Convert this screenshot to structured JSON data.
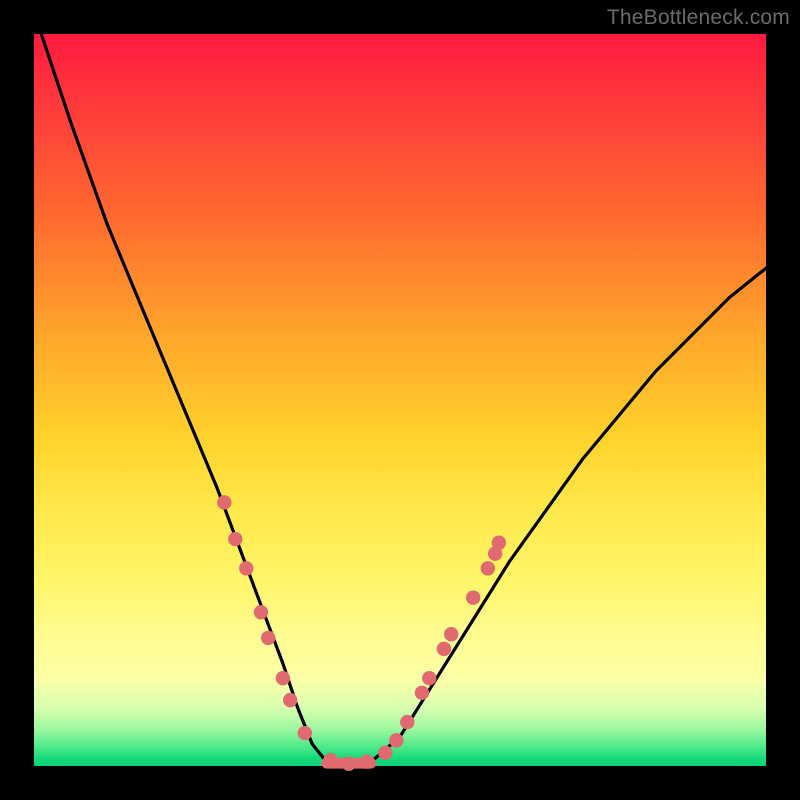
{
  "watermark": "TheBottleneck.com",
  "colors": {
    "frame": "#000000",
    "curve": "#000000",
    "dot": "#e06a6f",
    "gradient_top": "#ff1a3f",
    "gradient_bottom": "#0fd176"
  },
  "chart_data": {
    "type": "line",
    "title": "",
    "xlabel": "",
    "ylabel": "",
    "xlim": [
      0,
      100
    ],
    "ylim": [
      0,
      100
    ],
    "series": [
      {
        "name": "bottleneck-curve",
        "x": [
          1,
          5,
          10,
          15,
          20,
          25,
          28,
          31,
          34,
          36,
          38,
          40,
          43,
          46,
          50,
          55,
          60,
          65,
          70,
          75,
          80,
          85,
          90,
          95,
          100
        ],
        "values": [
          100,
          88,
          74,
          62,
          50,
          38,
          30,
          22,
          14,
          8,
          3,
          0.5,
          0,
          0.5,
          4,
          12,
          20,
          28,
          35,
          42,
          48,
          54,
          59,
          64,
          68
        ]
      }
    ],
    "markers": [
      {
        "x": 26,
        "y": 36
      },
      {
        "x": 27.5,
        "y": 31
      },
      {
        "x": 29,
        "y": 27
      },
      {
        "x": 31,
        "y": 21
      },
      {
        "x": 32,
        "y": 17.5
      },
      {
        "x": 34,
        "y": 12
      },
      {
        "x": 35,
        "y": 9
      },
      {
        "x": 37,
        "y": 4.5
      },
      {
        "x": 40.5,
        "y": 0.8
      },
      {
        "x": 43,
        "y": 0.3
      },
      {
        "x": 45.5,
        "y": 0.6
      },
      {
        "x": 48,
        "y": 1.8
      },
      {
        "x": 49.5,
        "y": 3.5
      },
      {
        "x": 51,
        "y": 6
      },
      {
        "x": 53,
        "y": 10
      },
      {
        "x": 54,
        "y": 12
      },
      {
        "x": 56,
        "y": 16
      },
      {
        "x": 57,
        "y": 18
      },
      {
        "x": 60,
        "y": 23
      },
      {
        "x": 62,
        "y": 27
      },
      {
        "x": 63,
        "y": 29
      },
      {
        "x": 63.5,
        "y": 30.5
      }
    ],
    "flat_bottom": {
      "x_start": 40,
      "x_end": 46,
      "y": 0.4
    }
  }
}
